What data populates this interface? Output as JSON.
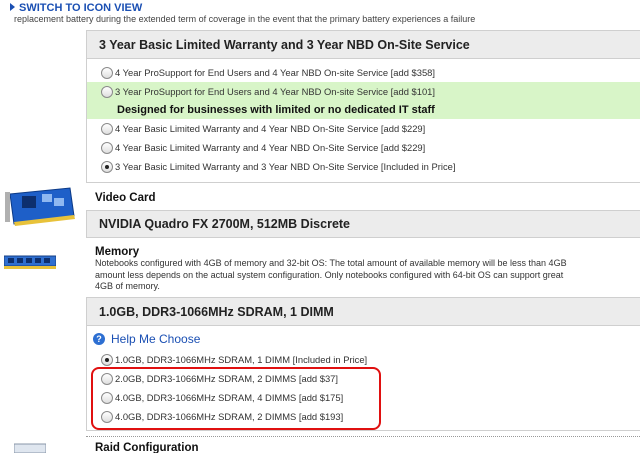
{
  "top_link": {
    "label": "SWITCH TO ICON VIEW"
  },
  "clipped_text": "replacement battery during the extended term of coverage in the event that the primary battery experiences a failure",
  "warranty": {
    "selected_title": "3 Year Basic Limited Warranty and 3 Year NBD On-Site Service",
    "options": [
      {
        "label": "4 Year ProSupport for End Users and 4 Year NBD On-site Service [add $358]"
      },
      {
        "label": "3 Year ProSupport for End Users and 4 Year NBD On-site Service [add $101]"
      },
      {
        "label": "4 Year Basic Limited Warranty and 4 Year NBD On-Site Service [add $229]"
      },
      {
        "label": "4 Year Basic Limited Warranty and 4 Year NBD On-Site Service [add $229]"
      },
      {
        "label": "3 Year Basic Limited Warranty and 3 Year NBD On-Site Service [Included in Price]"
      }
    ],
    "highlight_note": "Designed for businesses with limited or no dedicated IT staff"
  },
  "video": {
    "title": "Video Card",
    "selected": "NVIDIA Quadro FX 2700M, 512MB Discrete",
    "icon": "video-card-icon"
  },
  "memory": {
    "title": "Memory",
    "description": [
      "Notebooks configured with 4GB of memory and 32-bit OS: The total amount of available memory will be less than 4GB",
      "amount less depends on the actual system configuration. Only notebooks configured with 64-bit OS can support great",
      "4GB of memory."
    ],
    "selected_title": "1.0GB, DDR3-1066MHz SDRAM, 1 DIMM",
    "help_label": "Help Me Choose",
    "options": [
      {
        "label": "1.0GB, DDR3-1066MHz SDRAM, 1 DIMM [Included in Price]"
      },
      {
        "label": "2.0GB, DDR3-1066MHz SDRAM, 2 DIMMS [add $37]"
      },
      {
        "label": "4.0GB, DDR3-1066MHz SDRAM, 4 DIMMS [add $175]"
      },
      {
        "label": "4.0GB, DDR3-1066MHz SDRAM, 2 DIMMS [add $193]"
      }
    ],
    "icon": "memory-module-icon"
  },
  "raid": {
    "title": "Raid Configuration",
    "icon": "drive-icon"
  },
  "colors": {
    "link": "#1a4fb3",
    "highlight": "#d8f5c8",
    "callout": "#e01010",
    "panel_head": "#ececec"
  }
}
